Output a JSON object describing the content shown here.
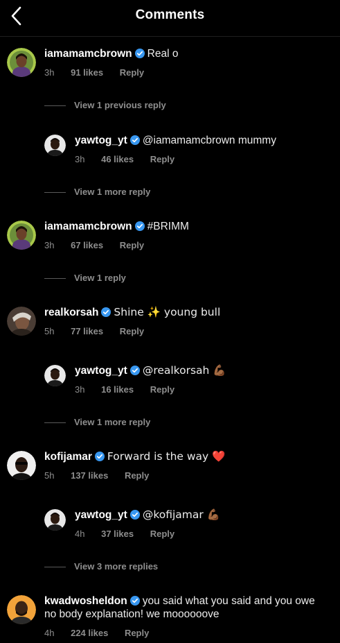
{
  "header": {
    "title": "Comments"
  },
  "comments": [
    {
      "username": "iamamamcbrown",
      "text": "Real o",
      "time": "3h",
      "likes": "91 likes",
      "reply": "Reply"
    },
    {
      "view": "View 1 previous reply"
    },
    {
      "username": "yawtog_yt",
      "text": "@iamamamcbrown mummy",
      "time": "3h",
      "likes": "46 likes",
      "reply": "Reply"
    },
    {
      "view": "View 1 more reply"
    },
    {
      "username": "iamamamcbrown",
      "text": "#BRIMM",
      "time": "3h",
      "likes": "67 likes",
      "reply": "Reply"
    },
    {
      "view": "View 1 reply"
    },
    {
      "username": "realkorsah",
      "text": "Shine ✨ young bull",
      "time": "5h",
      "likes": "77 likes",
      "reply": "Reply"
    },
    {
      "username": "yawtog_yt",
      "text": "@realkorsah 💪🏾",
      "time": "3h",
      "likes": "16 likes",
      "reply": "Reply"
    },
    {
      "view": "View 1 more reply"
    },
    {
      "username": "kofijamar",
      "text": "Forward is the way ❤️",
      "time": "5h",
      "likes": "137 likes",
      "reply": "Reply"
    },
    {
      "username": "yawtog_yt",
      "text": "@kofijamar 💪🏾",
      "time": "4h",
      "likes": "37 likes",
      "reply": "Reply"
    },
    {
      "view": "View 3 more replies"
    },
    {
      "username": "kwadwosheldon",
      "text": "you said what you said and you owe no body explanation! we moooooove",
      "time": "4h",
      "likes": "224 likes",
      "reply": "Reply"
    }
  ],
  "colors": {
    "background": "#000000",
    "verified": "#3897f0",
    "secondary_text": "#8e8e8e"
  },
  "icons": {
    "back": "chevron-left-icon",
    "verified": "verified-badge-icon"
  }
}
